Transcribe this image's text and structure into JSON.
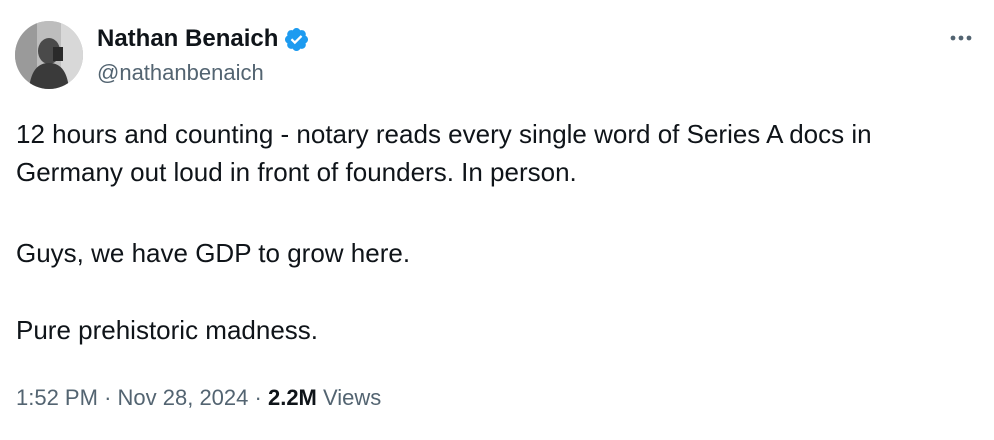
{
  "author": {
    "name": "Nathan Benaich",
    "handle": "@nathanbenaich",
    "verified": true,
    "verified_color": "#1d9bf0"
  },
  "tweet": {
    "paragraphs": [
      "12 hours and counting - notary reads every single word of Series A docs in Germany out loud in front of founders. In person.",
      "Guys, we have GDP to grow here.",
      "Pure prehistoric madness."
    ],
    "time": "1:52 PM",
    "separator": "·",
    "date": "Nov 28, 2024",
    "views_count": "2.2M",
    "views_label": "Views"
  },
  "icons": {
    "more": "more-options-icon",
    "verified": "verified-badge-icon",
    "avatar": "avatar"
  },
  "colors": {
    "text": "#0f1419",
    "secondary": "#536471",
    "background": "#ffffff"
  }
}
